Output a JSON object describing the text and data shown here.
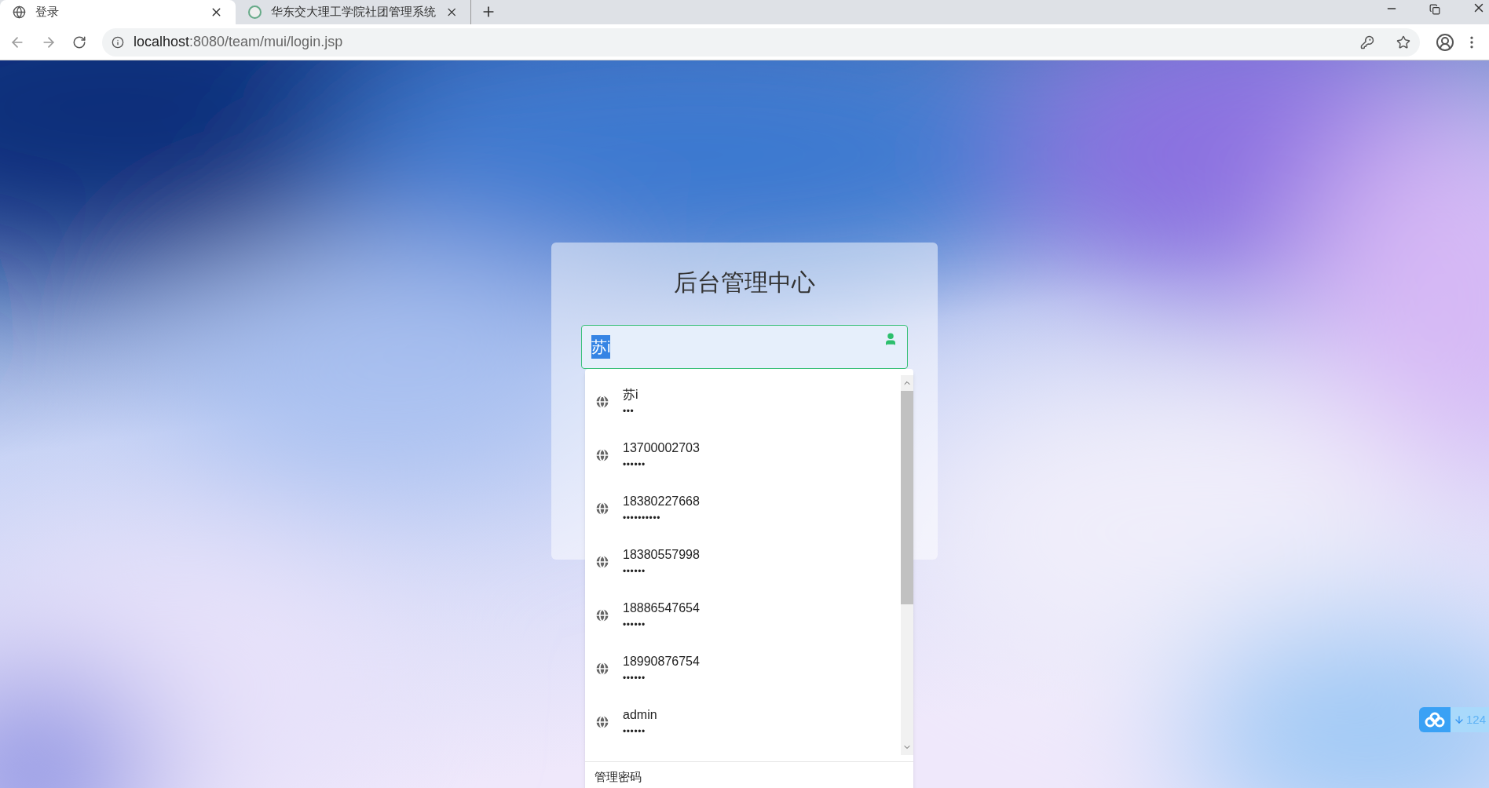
{
  "browser": {
    "tabs": [
      {
        "title": "登录",
        "selected": true
      },
      {
        "title": "华东交大理工学院社团管理系统",
        "selected": false
      }
    ],
    "address": {
      "host": "localhost",
      "path": ":8080/team/mui/login.jsp"
    }
  },
  "login": {
    "title": "后台管理中心",
    "username": {
      "value": "苏i",
      "selected": true
    }
  },
  "autocomplete": {
    "items": [
      {
        "username": "苏i",
        "password": "•••"
      },
      {
        "username": "13700002703",
        "password": "••••••"
      },
      {
        "username": "18380227668",
        "password": "••••••••••"
      },
      {
        "username": "18380557998",
        "password": "••••••"
      },
      {
        "username": "18886547654",
        "password": "••••••"
      },
      {
        "username": "18990876754",
        "password": "••••••"
      },
      {
        "username": "admin",
        "password": "••••••"
      }
    ],
    "footer": "管理密码"
  },
  "widget": {
    "count": "124"
  }
}
